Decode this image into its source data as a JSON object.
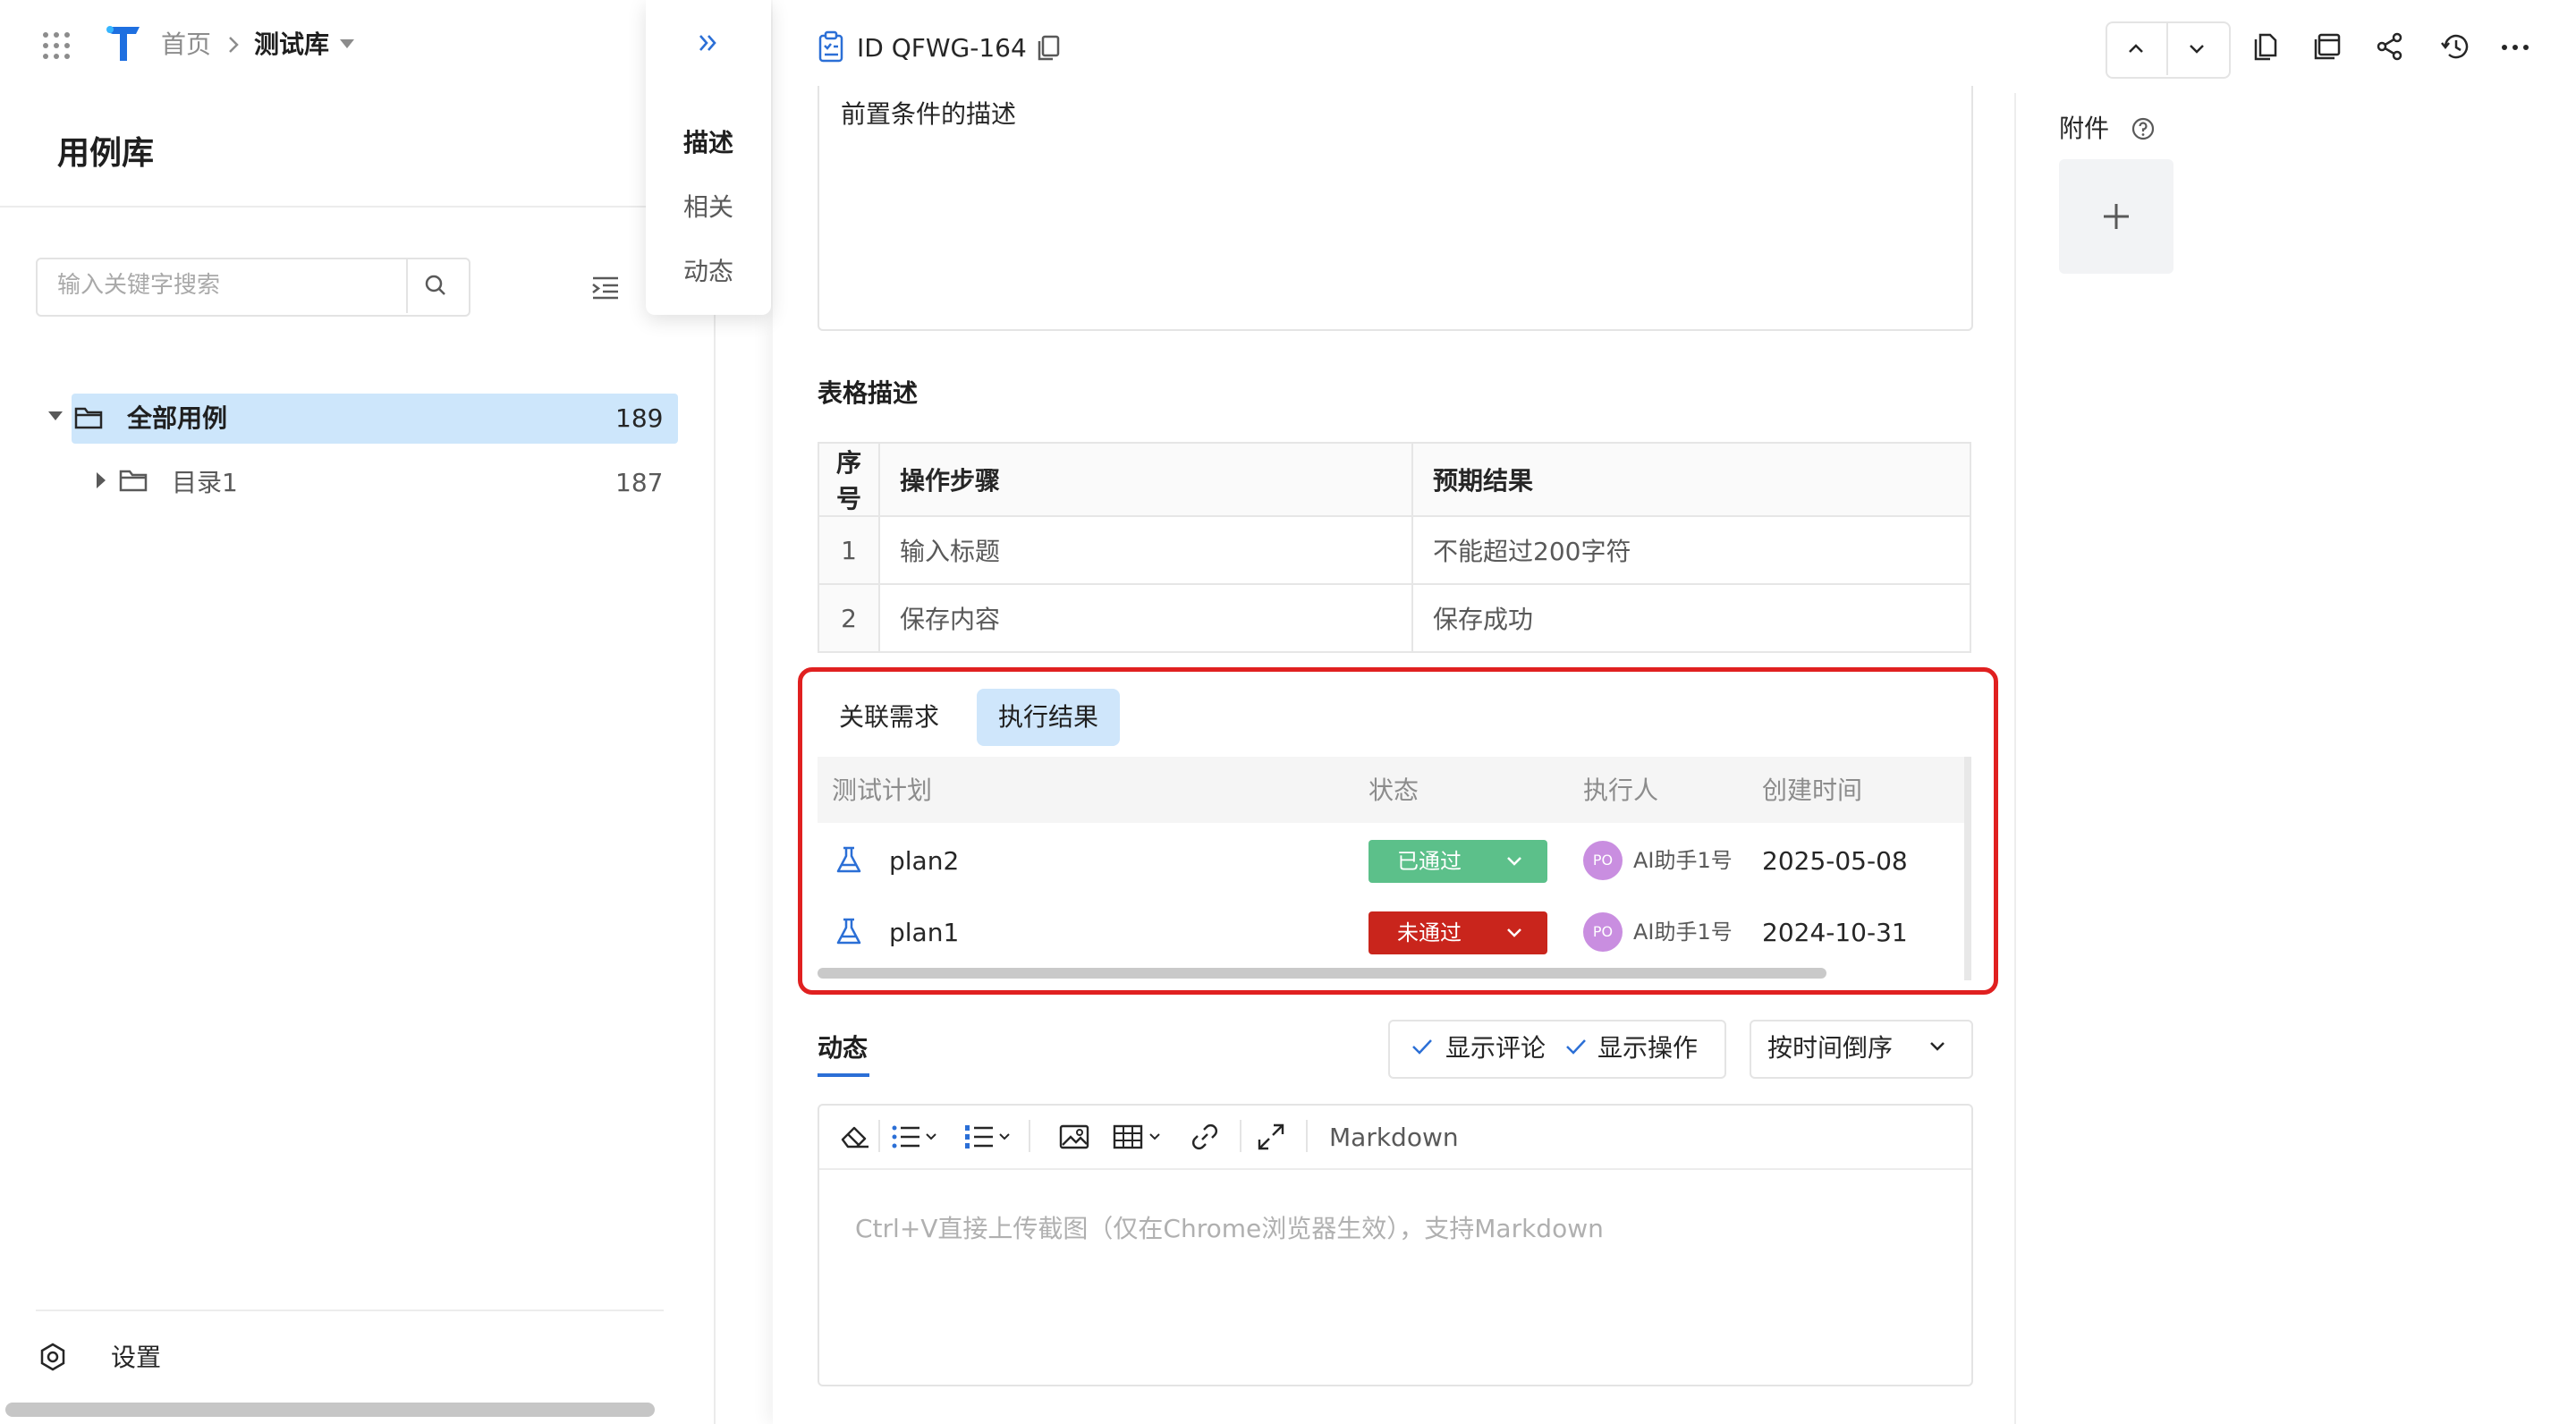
{
  "header": {
    "breadcrumb_home": "首页",
    "breadcrumb_current": "测试库"
  },
  "sidebar": {
    "title": "用例库",
    "search_placeholder": "输入关键字搜索",
    "tree": [
      {
        "label": "全部用例",
        "count": "189",
        "selected": true
      },
      {
        "label": "目录1",
        "count": "187",
        "selected": false
      }
    ],
    "settings_label": "设置"
  },
  "anchor_nav": {
    "items": [
      "描述",
      "相关",
      "动态"
    ]
  },
  "detail": {
    "id_text": "ID QFWG-164",
    "precondition_text": "前置条件的描述",
    "attachments_label": "附件",
    "table_section_title": "表格描述",
    "table": {
      "headers": [
        "序号",
        "操作步骤",
        "预期结果"
      ],
      "rows": [
        [
          "1",
          "输入标题",
          "不能超过200字符"
        ],
        [
          "2",
          "保存内容",
          "保存成功"
        ]
      ]
    },
    "tabs": [
      "关联需求",
      "执行结果"
    ],
    "active_tab": "执行结果",
    "exec_headers": [
      "测试计划",
      "状态",
      "执行人",
      "创建时间"
    ],
    "exec_rows": [
      {
        "plan": "plan2",
        "status": "已通过",
        "status_color": "#5cc08a",
        "avatar": "PO",
        "executor": "AI助手1号",
        "created": "2025-05-08"
      },
      {
        "plan": "plan1",
        "status": "未通过",
        "status_color": "#c9251c",
        "avatar": "PO",
        "executor": "AI助手1号",
        "created": "2024-10-31"
      }
    ]
  },
  "activity": {
    "title": "动态",
    "show_comments": "显示评论",
    "show_operations": "显示操作",
    "sort_label": "按时间倒序",
    "editor_mode": "Markdown",
    "editor_placeholder": "Ctrl+V直接上传截图（仅在Chrome浏览器生效），支持Markdown"
  },
  "colors": {
    "accent": "#2b6fd6",
    "selected_bg": "#cde6fb",
    "highlight_frame": "#e02020"
  }
}
